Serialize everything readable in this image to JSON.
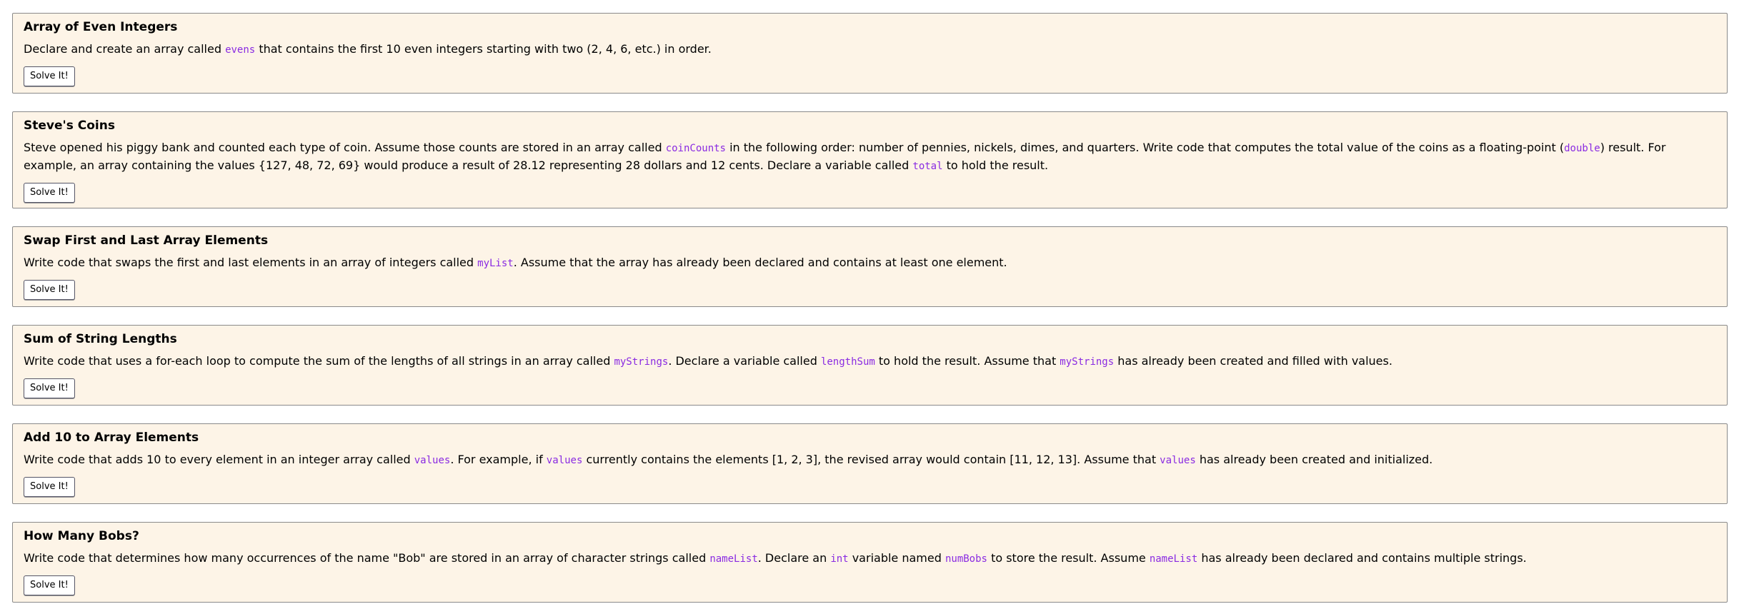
{
  "button_label": "Solve It!",
  "accent_color": "#8a2be2",
  "card_background": "#fdf4e7",
  "exercises": [
    {
      "title": "Array of Even Integers",
      "segments": [
        {
          "t": "Declare and create an array called "
        },
        {
          "c": "evens"
        },
        {
          "t": " that contains the first 10 even integers starting with two (2, 4, 6, etc.) in order."
        }
      ]
    },
    {
      "title": "Steve's Coins",
      "segments": [
        {
          "t": "Steve opened his piggy bank and counted each type of coin. Assume those counts are stored in an array called "
        },
        {
          "c": "coinCounts"
        },
        {
          "t": " in the following order: number of pennies, nickels, dimes, and quarters. Write code that computes the total value of the coins as a floating-point ("
        },
        {
          "c": "double"
        },
        {
          "t": ") result. For example, an array containing the values {127, 48, 72, 69} would produce a result of 28.12 representing 28 dollars and 12 cents. Declare a variable called "
        },
        {
          "c": "total"
        },
        {
          "t": " to hold the result."
        }
      ]
    },
    {
      "title": "Swap First and Last Array Elements",
      "segments": [
        {
          "t": "Write code that swaps the first and last elements in an array of integers called "
        },
        {
          "c": "myList"
        },
        {
          "t": ". Assume that the array has already been declared and contains at least one element."
        }
      ]
    },
    {
      "title": "Sum of String Lengths",
      "segments": [
        {
          "t": "Write code that uses a for-each loop to compute the sum of the lengths of all strings in an array called "
        },
        {
          "c": "myStrings"
        },
        {
          "t": ". Declare a variable called "
        },
        {
          "c": "lengthSum"
        },
        {
          "t": " to hold the result. Assume that "
        },
        {
          "c": "myStrings"
        },
        {
          "t": " has already been created and filled with values."
        }
      ]
    },
    {
      "title": "Add 10 to Array Elements",
      "segments": [
        {
          "t": "Write code that adds 10 to every element in an integer array called "
        },
        {
          "c": "values"
        },
        {
          "t": ". For example, if "
        },
        {
          "c": "values"
        },
        {
          "t": " currently contains the elements [1, 2, 3], the revised array would contain [11, 12, 13]. Assume that "
        },
        {
          "c": "values"
        },
        {
          "t": " has already been created and initialized."
        }
      ]
    },
    {
      "title": "How Many Bobs?",
      "segments": [
        {
          "t": "Write code that determines how many occurrences of the name \"Bob\" are stored in an array of character strings called "
        },
        {
          "c": "nameList"
        },
        {
          "t": ". Declare an "
        },
        {
          "c": "int"
        },
        {
          "t": " variable named "
        },
        {
          "c": "numBobs"
        },
        {
          "t": " to store the result. Assume "
        },
        {
          "c": "nameList"
        },
        {
          "t": " has already been declared and contains multiple strings."
        }
      ]
    }
  ]
}
